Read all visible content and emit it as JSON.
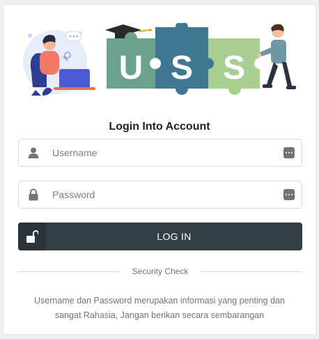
{
  "brand": {
    "letters": [
      "U",
      "S",
      "S"
    ]
  },
  "title": "Login Into Account",
  "username": {
    "placeholder": "Username",
    "value": ""
  },
  "password": {
    "placeholder": "Password",
    "value": ""
  },
  "login_button": {
    "label": "LOG IN"
  },
  "divider_text": "Security Check",
  "notice": "Username dan Password merupakan informasi yang penting dan sangat Rahasia, Jangan berikan secara sembarangan",
  "colors": {
    "puzzle_green": "#6aa28e",
    "puzzle_blue": "#3f7890",
    "puzzle_light": "#a8cf8f",
    "button": "#343e45",
    "button_icon_bg": "#2b343a"
  }
}
